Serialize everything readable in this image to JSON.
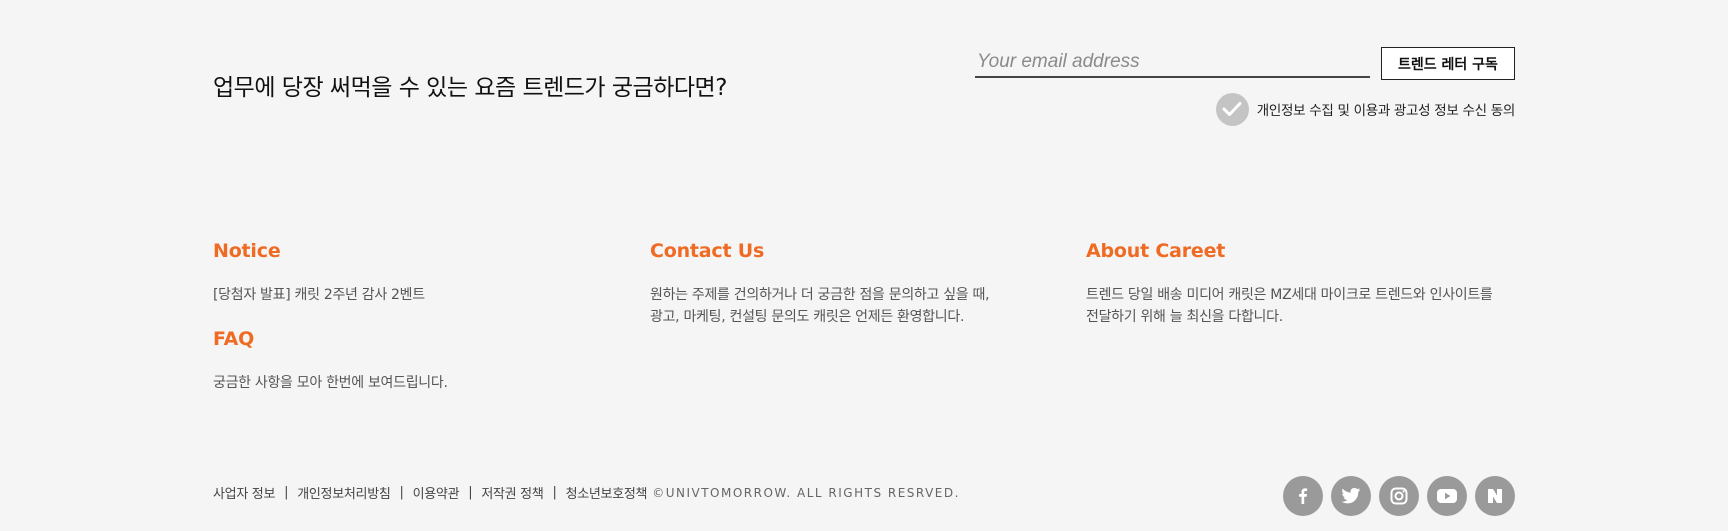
{
  "newsletter": {
    "heading": "업무에 당장 써먹을 수 있는 요즘 트렌드가 궁금하다면?",
    "email_placeholder": "Your email address",
    "subscribe_label": "트렌드 레터 구독",
    "consent_label": "개인정보 수집 및 이용과 광고성 정보 수신 동의"
  },
  "columns": {
    "notice": {
      "title": "Notice",
      "text": "[당첨자 발표] 캐릿 2주년 감사 2벤트",
      "faq_title": "FAQ",
      "faq_text": "궁금한 사항을 모아 한번에 보여드립니다."
    },
    "contact": {
      "title": "Contact Us",
      "line1": "원하는 주제를 건의하거나 더 궁금한 점을 문의하고 싶을 때,",
      "line2": "광고, 마케팅, 컨설팅 문의도 캐릿은 언제든 환영합니다."
    },
    "about": {
      "title": "About Careet",
      "line1": "트렌드 당일 배송 미디어 캐릿은 MZ세대 마이크로 트렌드와 인사이트를",
      "line2": "전달하기 위해 늘 최신을 다합니다."
    }
  },
  "footer": {
    "links": [
      "사업자 정보",
      "개인정보처리방침",
      "이용약관",
      "저작권 정책",
      "청소년보호정책"
    ],
    "separator": "|",
    "copyright": "©UNIVTOMORROW. ALL RIGHTS RESRVED.",
    "social_icons": [
      "facebook-icon",
      "twitter-icon",
      "instagram-icon",
      "youtube-icon",
      "naver-icon"
    ]
  },
  "colors": {
    "accent": "#ef6b24",
    "background": "#f5f5f5",
    "social_bg": "#9a9a9a",
    "check_bg": "#c4c4c4"
  }
}
